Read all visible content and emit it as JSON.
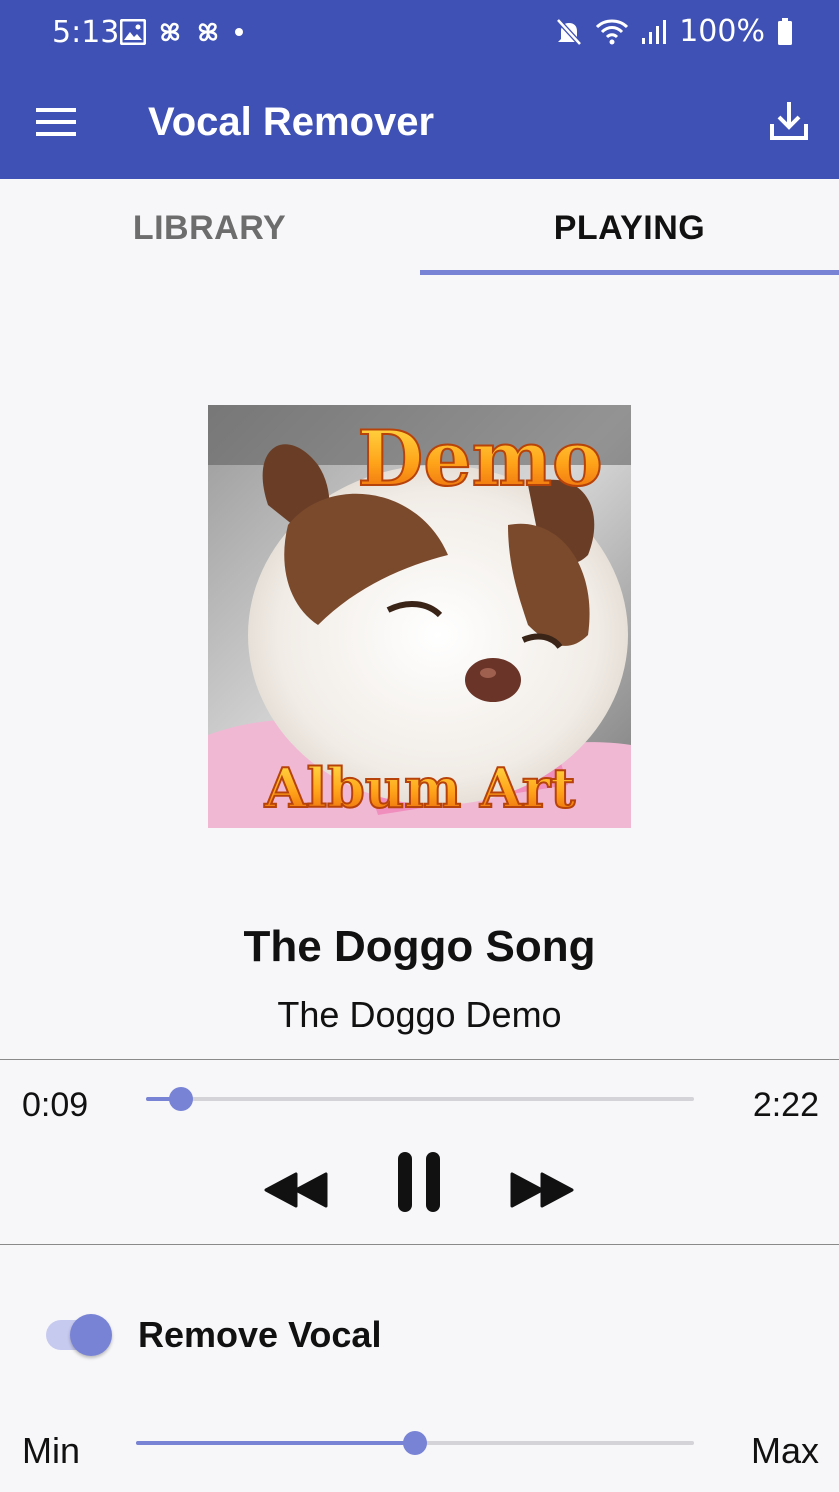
{
  "status_bar": {
    "time": "5:13",
    "battery": "100%",
    "icons_left": [
      "gallery-icon",
      "pinwheel-icon",
      "pinwheel-icon",
      "dot-icon"
    ],
    "icons_right": [
      "mute-icon",
      "wifi-icon",
      "signal-icon",
      "battery-icon"
    ]
  },
  "app_bar": {
    "title": "Vocal Remover",
    "background": "#3f51b5",
    "menu_icon": "hamburger-menu-icon",
    "action_icon": "download-icon"
  },
  "tabs": [
    {
      "label": "LIBRARY",
      "selected": false
    },
    {
      "label": "PLAYING",
      "selected": true
    }
  ],
  "album_art": {
    "text_top": "Demo",
    "text_bottom": "Album Art"
  },
  "track": {
    "title": "The Doggo Song",
    "artist": "The Doggo Demo"
  },
  "player": {
    "elapsed": "0:09",
    "duration": "2:22",
    "progress": 0.063,
    "controls": [
      "rewind-icon",
      "pause-icon",
      "fast-forward-icon"
    ]
  },
  "vocal": {
    "toggle_label": "Remove Vocal",
    "toggle_on": true,
    "min_label": "Min",
    "max_label": "Max",
    "level": 0.5
  },
  "colors": {
    "accent": "#7883d6",
    "primary": "#3f51b5",
    "track_inactive": "#d3d3d8"
  }
}
